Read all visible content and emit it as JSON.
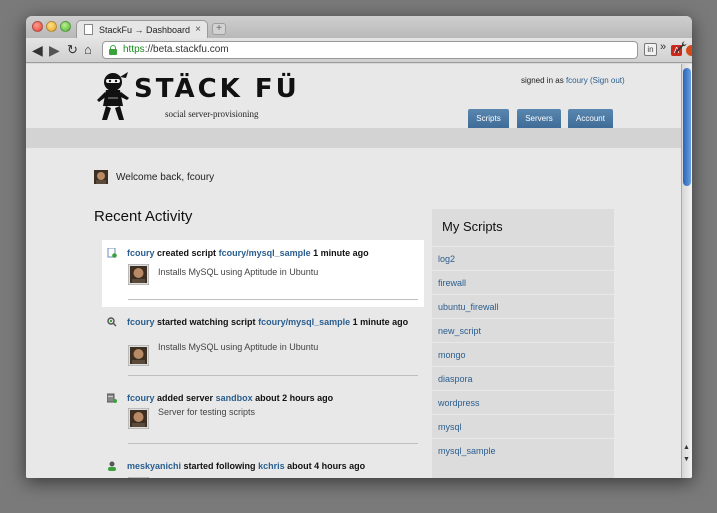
{
  "browser": {
    "tab_title": "StackFu → Dashboard",
    "tab_close": "×",
    "new_tab": "+",
    "url_scheme": "https",
    "url_rest": "://beta.stackfu.com",
    "nav_icons": {
      "back": "◀",
      "forward": "▶",
      "reload": "↻",
      "home": "⌂"
    },
    "ext_pdf": "A",
    "ext_in": "in",
    "more": "»",
    "star": "☆",
    "wrench": "🔧"
  },
  "site": {
    "title": "STÄCK FÜ",
    "tagline": "social server-provisioning",
    "signed_in_prefix": "signed in as",
    "username": "fcoury",
    "sign_out": "(Sign out)",
    "nav": {
      "scripts": "Scripts",
      "servers": "Servers",
      "account": "Account"
    }
  },
  "welcome": "Welcome back, fcoury",
  "recent_activity": {
    "title": "Recent Activity",
    "items": [
      {
        "user": "fcoury",
        "verb": "created script",
        "target": "fcoury/mysql_sample",
        "time": "1 minute ago",
        "description": "Installs MySQL using Aptitude in Ubuntu",
        "icon": "script-add-icon"
      },
      {
        "user": "fcoury",
        "verb": "started watching script",
        "target": "fcoury/mysql_sample",
        "time": "1 minute ago",
        "description": "Installs MySQL using Aptitude in Ubuntu",
        "icon": "watch-icon"
      },
      {
        "user": "fcoury",
        "verb": "added server",
        "target": "sandbox",
        "time": "about 2 hours ago",
        "description": "Server for testing scripts",
        "icon": "server-add-icon"
      },
      {
        "user": "meskyanichi",
        "verb": "started following",
        "target": "kchris",
        "time": "about 4 hours ago",
        "description": "",
        "icon": "follow-icon"
      }
    ]
  },
  "my_scripts": {
    "title": "My Scripts",
    "items": [
      "log2",
      "firewall",
      "ubuntu_firewall",
      "new_script",
      "mongo",
      "diaspora",
      "wordpress",
      "mysql",
      "mysql_sample"
    ]
  },
  "colors": {
    "link": "#2a5e8f",
    "nav_button": "#4a77a2",
    "https_green": "#178a1a"
  }
}
